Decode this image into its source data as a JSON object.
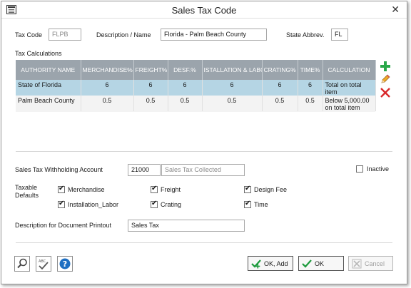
{
  "window": {
    "title": "Sales Tax Code"
  },
  "header": {
    "tax_code_label": "Tax Code",
    "tax_code_value": "FLPB",
    "description_label": "Description / Name",
    "description_value": "Florida - Palm Beach County",
    "state_label": "State Abbrev.",
    "state_value": "FL"
  },
  "calc": {
    "section_label": "Tax Calculations",
    "columns": [
      "AUTHORITY NAME",
      "MERCHANDISE%",
      "FREIGHT%",
      "DESF.%",
      "ISTALLATION & LABO",
      "CRATING%",
      "TIME%",
      "CALCULATION"
    ],
    "rows": [
      {
        "name": "State of Florida",
        "merch": "6",
        "freight": "6",
        "desf": "6",
        "install": "6",
        "crating": "6",
        "time": "6",
        "calc": "Total on total item"
      },
      {
        "name": "Palm Beach County",
        "merch": "0.5",
        "freight": "0.5",
        "desf": "0.5",
        "install": "0.5",
        "crating": "0.5",
        "time": "0.5",
        "calc": "Below 5,000.00 on total item"
      }
    ]
  },
  "withholding": {
    "label": "Sales Tax Withholding Account",
    "account_value": "21000",
    "account_desc": "Sales Tax Collected",
    "inactive_label": "Inactive"
  },
  "defaults": {
    "label_line1": "Taxable",
    "label_line2": "Defaults",
    "merchandise": "Merchandise",
    "freight": "Freight",
    "design_fee": "Design Fee",
    "installation": "Installation_Labor",
    "crating": "Crating",
    "time": "Time"
  },
  "printout": {
    "label": "Description for Document Printout",
    "value": "Sales Tax"
  },
  "buttons": {
    "ok_add": "OK, Add",
    "ok": "OK",
    "cancel": "Cancel"
  },
  "colors": {
    "grid_header": "#9ba4ac",
    "selected_row": "#b5d5e4",
    "add_icon": "#2aa84a",
    "delete_icon": "#d8282b",
    "ok_check": "#1c9a3c",
    "help_icon": "#1e6fc2"
  },
  "icons": [
    "app-icon",
    "close-icon",
    "add-icon",
    "edit-pencil-icon",
    "delete-icon",
    "search-icon",
    "spellcheck-icon",
    "help-icon",
    "check-icon",
    "cancel-icon"
  ]
}
